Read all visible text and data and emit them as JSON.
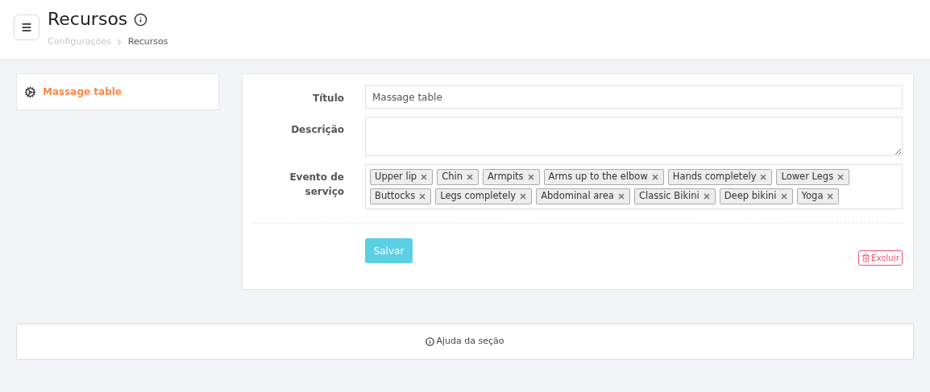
{
  "header": {
    "title": "Recursos",
    "breadcrumb": [
      "Configurações",
      "Recursos"
    ]
  },
  "sidebar": {
    "items": [
      {
        "label": "Massage table",
        "selected": true
      }
    ]
  },
  "form": {
    "fields": [
      {
        "kind": "text",
        "label": "Título",
        "value": "Massage table"
      },
      {
        "kind": "textarea",
        "label": "Descrição"
      },
      {
        "kind": "tags",
        "label": "Evento de serviço",
        "tags": [
          "Upper lip",
          "Chin",
          "Armpits",
          "Arms up to the elbow",
          "Hands completely",
          "Lower Legs",
          "Buttocks",
          "Legs completely",
          "Abdominal area",
          "Classic Bikini",
          "Deep bikini",
          "Yoga"
        ]
      }
    ],
    "save_button": "Salvar",
    "delete_button": "Excluir"
  },
  "help": {
    "label": "Ajuda da seção"
  }
}
